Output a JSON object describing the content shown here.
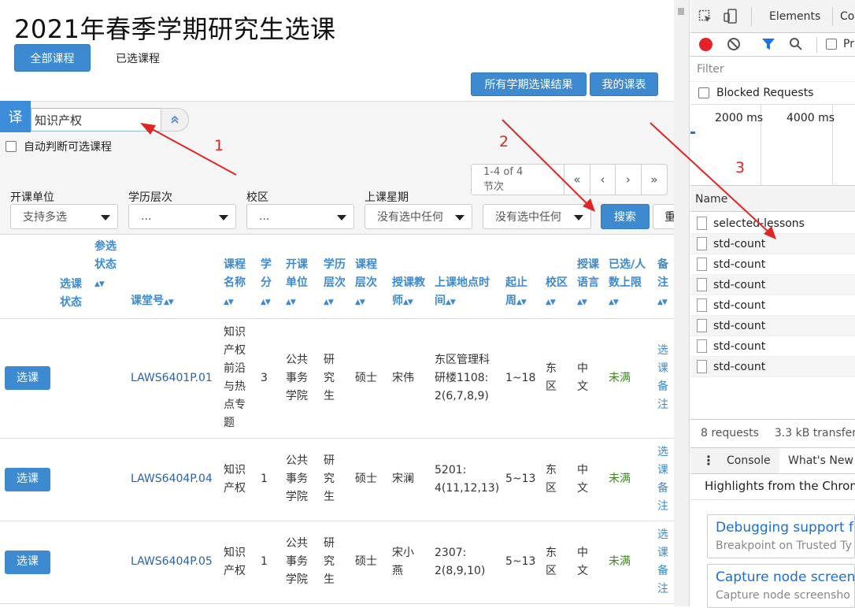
{
  "page": {
    "title": "2021年春季学期研究生选课"
  },
  "tabs": {
    "all_courses": "全部课程",
    "selected_courses": "已选课程"
  },
  "actions": {
    "all_results": "所有学期选课结果",
    "my_timetable": "我的课表"
  },
  "search": {
    "badge": "译",
    "value": "知识产权",
    "collapse_icon": "chevron-up-double-icon"
  },
  "auto_check": {
    "label": "自动判断可选课程",
    "checked": false
  },
  "pager": {
    "info_line1": "1-4 of 4",
    "info_line2": "节次",
    "first": "«",
    "prev": "‹",
    "next": "›",
    "last": "»"
  },
  "filters": {
    "dept": {
      "label": "开课单位",
      "value": "支持多选"
    },
    "level": {
      "label": "学历层次",
      "value": "..."
    },
    "campus": {
      "label": "校区",
      "value": "..."
    },
    "weekday": {
      "label": "上课星期",
      "value": "没有选中任何"
    },
    "period": {
      "label": "",
      "value": "没有选中任何"
    },
    "search_button": "搜索",
    "reset_button": "重"
  },
  "table": {
    "headers": {
      "select_status": "选课状态",
      "join_status": "参选状态",
      "code": "课堂号",
      "name": "课程名称",
      "credit": "学分",
      "dept": "开课单位",
      "level": "学历层次",
      "course_level": "课程层次",
      "teacher": "授课教师",
      "place_time": "上课地点时间",
      "weeks": "起止周",
      "campus": "校区",
      "lang": "授课语言",
      "quota": "已选/人数上限",
      "note": "备注"
    },
    "rows": [
      {
        "btn": "选课",
        "code": "LAWS6401P.01",
        "name": "知识产权前沿与热点专题",
        "credit": "3",
        "dept": "公共事务学院",
        "level": "研究生",
        "course_level": "硕士",
        "teacher": "宋伟",
        "place_time": "东区管理科研楼1108: 2(6,7,8,9)",
        "weeks": "1~18",
        "campus": "东区",
        "lang": "中文",
        "quota": "未满",
        "note": "选课备注"
      },
      {
        "btn": "选课",
        "code": "LAWS6404P.04",
        "name": "知识产权",
        "credit": "1",
        "dept": "公共事务学院",
        "level": "研究生",
        "course_level": "硕士",
        "teacher": "宋澜",
        "place_time": "5201: 4(11,12,13)",
        "weeks": "5~13",
        "campus": "东区",
        "lang": "中文",
        "quota": "未满",
        "note": "选课备注"
      },
      {
        "btn": "选课",
        "code": "LAWS6404P.05",
        "name": "知识产权",
        "credit": "1",
        "dept": "公共事务学院",
        "level": "研究生",
        "course_level": "硕士",
        "teacher": "宋小燕",
        "place_time": "2307: 2(8,9,10)",
        "weeks": "5~13",
        "campus": "东区",
        "lang": "中文",
        "quota": "未满",
        "note": "选课备注"
      }
    ]
  },
  "devtools": {
    "tabs": {
      "elements": "Elements",
      "console_tab_partial": "Co"
    },
    "filter_placeholder": "Filter",
    "preserve_partial": "Pr",
    "blocked_requests": "Blocked Requests",
    "timeline": {
      "t1": "2000 ms",
      "t2": "4000 ms"
    },
    "name_header": "Name",
    "requests": [
      "selected-lessons",
      "std-count",
      "std-count",
      "std-count",
      "std-count",
      "std-count",
      "std-count",
      "std-count"
    ],
    "summary": {
      "requests": "8 requests",
      "transferred": "3.3 kB transferre"
    },
    "drawer_tabs": {
      "console": "Console",
      "whats_new": "What's New"
    },
    "highlights": "Highlights from the Chrome",
    "cards": [
      {
        "title": "Debugging support for",
        "subtitle": "Breakpoint on Trusted Ty"
      },
      {
        "title": "Capture node screensh",
        "subtitle": "Capture node screensho"
      }
    ]
  },
  "annotations": {
    "a1": "1",
    "a2": "2",
    "a3": "3"
  },
  "colors": {
    "primary": "#3e8ad0",
    "annotation": "#e02525",
    "status_open": "#3c8a1e"
  }
}
